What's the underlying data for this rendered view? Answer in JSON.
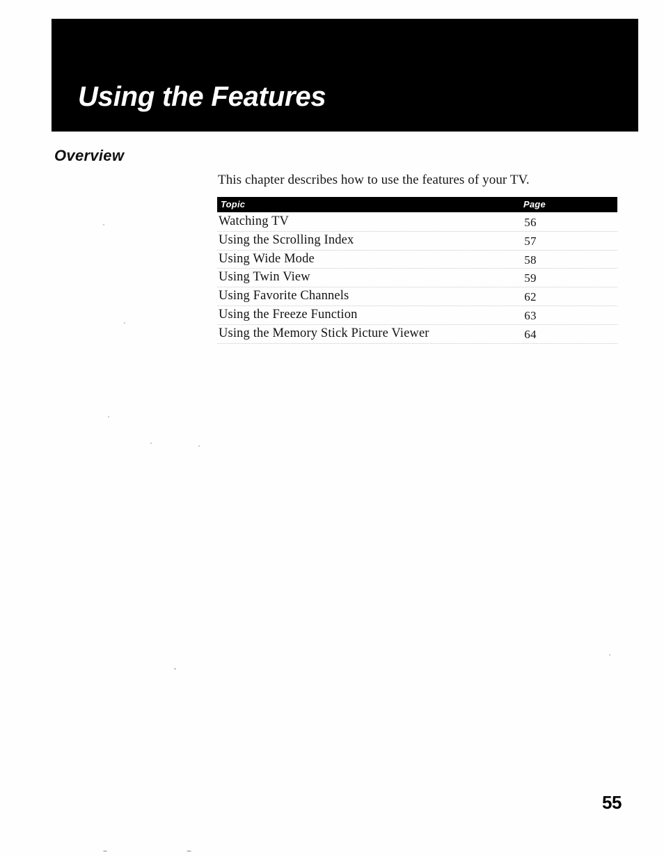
{
  "document": {
    "type": "manual-page",
    "background_color": "#ffffff",
    "banner_color": "#000000",
    "text_color": "#131313"
  },
  "banner": {
    "chapter_title": "Using the Features"
  },
  "section": {
    "heading": "Overview",
    "intro_text": "This chapter describes how to use the features of your TV."
  },
  "topic_table": {
    "columns": {
      "topic": "Topic",
      "page": "Page"
    },
    "rows": [
      {
        "topic": "Watching TV",
        "page": "56"
      },
      {
        "topic": "Using the Scrolling Index",
        "page": "57"
      },
      {
        "topic": "Using Wide Mode",
        "page": "58"
      },
      {
        "topic": "Using Twin View",
        "page": "59"
      },
      {
        "topic": "Using Favorite Channels",
        "page": "62"
      },
      {
        "topic": "Using the Freeze Function",
        "page": "63"
      },
      {
        "topic": "Using the Memory Stick Picture Viewer",
        "page": "64"
      }
    ]
  },
  "footer": {
    "page_number": "55"
  }
}
